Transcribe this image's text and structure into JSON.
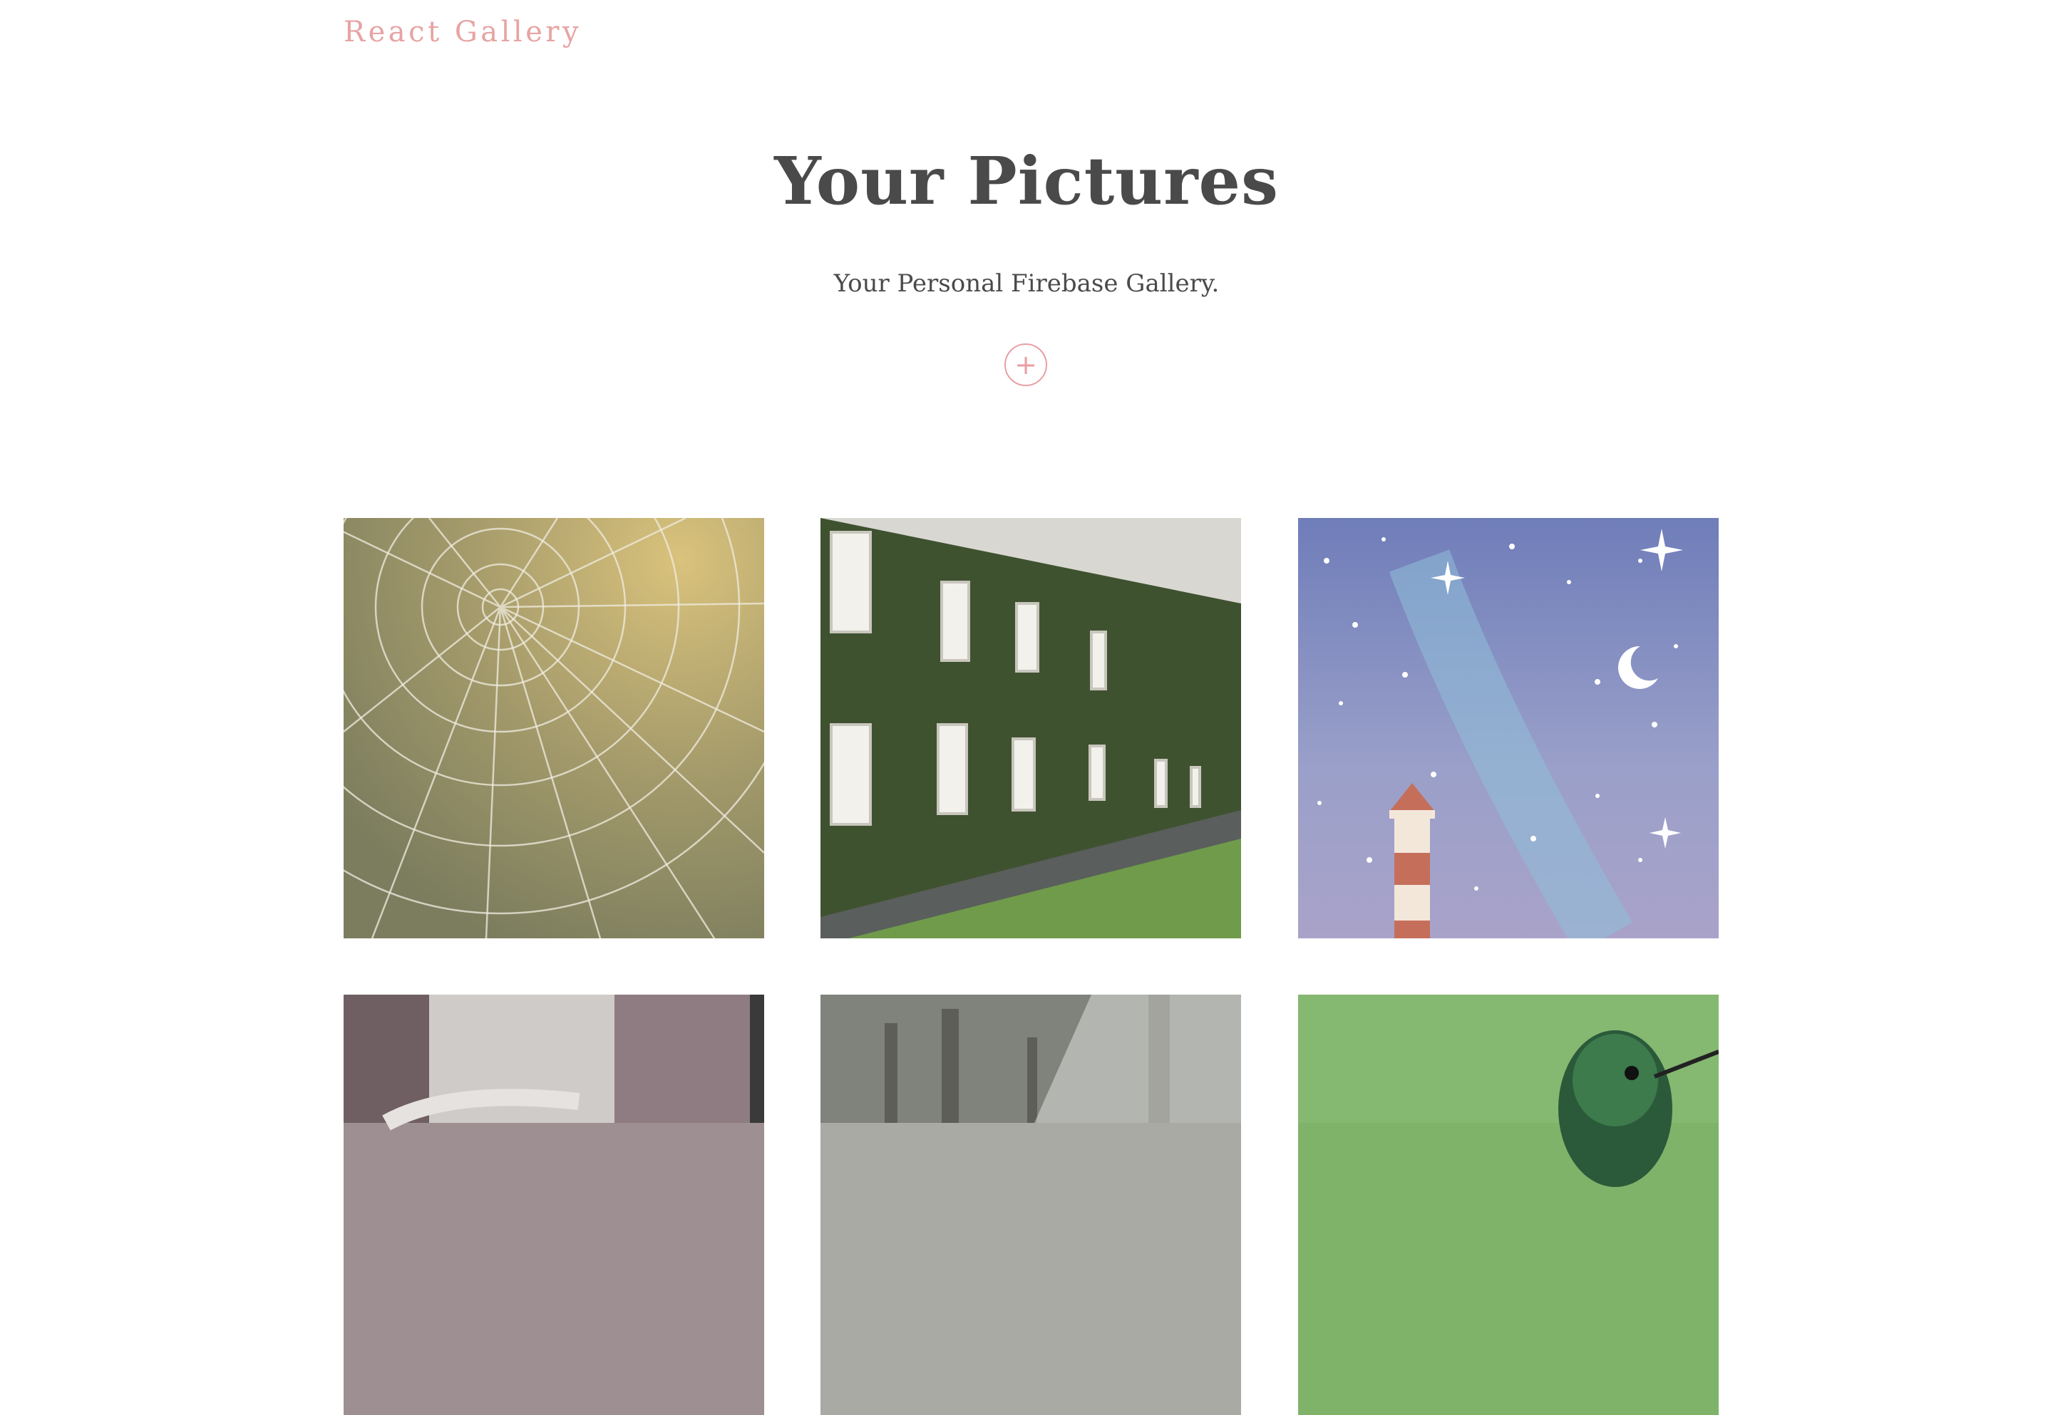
{
  "header": {
    "brand": "React Gallery"
  },
  "hero": {
    "title": "Your Pictures",
    "subtitle": "Your Personal Firebase Gallery.",
    "add_button_icon": "plus-icon"
  },
  "gallery": {
    "images": [
      {
        "subject": "spider web with dew drops"
      },
      {
        "subject": "ivy covered building"
      },
      {
        "subject": "lighthouse night sky illustration"
      },
      {
        "subject": "blurred interior"
      },
      {
        "subject": "misty forest"
      },
      {
        "subject": "hummingbird"
      }
    ]
  },
  "colors": {
    "accent": "#e7a3a3",
    "text": "#4a4a4a",
    "background": "#ffffff"
  }
}
